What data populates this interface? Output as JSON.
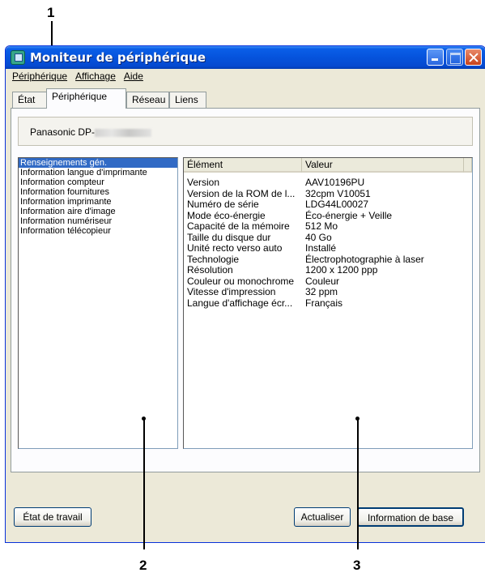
{
  "callouts": [
    "1",
    "2",
    "3"
  ],
  "window": {
    "title": "Moniteur de périphérique"
  },
  "menu": [
    {
      "label": "Périphérique"
    },
    {
      "label": "Affichage"
    },
    {
      "label": "Aide"
    }
  ],
  "tabs": [
    "État",
    "Périphérique",
    "Réseau",
    "Liens"
  ],
  "active_tab": "Périphérique",
  "device": {
    "name_prefix": "Panasonic DP-"
  },
  "left_list": [
    "Renseignements gén.",
    "Information langue d'imprimante",
    "Information compteur",
    "Information fournitures",
    "Information imprimante",
    "Information aire d'image",
    "Information numériseur",
    "Information télécopieur"
  ],
  "table": {
    "headers": [
      "Élément",
      "Valeur"
    ],
    "rows": [
      {
        "k": "Version",
        "v": "AAV10196PU"
      },
      {
        "k": "Version de la ROM de l...",
        "v": "32cpm V10051"
      },
      {
        "k": "Numéro de série",
        "v": "LDG44L00027"
      },
      {
        "k": "Mode éco-énergie",
        "v": "Éco-énergie + Veille"
      },
      {
        "k": "Capacité de la mémoire",
        "v": "512 Mo"
      },
      {
        "k": "Taille du disque dur",
        "v": "40 Go"
      },
      {
        "k": "Unité recto verso auto",
        "v": "Installé"
      },
      {
        "k": "Technologie",
        "v": "Électrophotographie à laser"
      },
      {
        "k": "Résolution",
        "v": "1200 x 1200 ppp"
      },
      {
        "k": "Couleur ou monochrome",
        "v": "Couleur"
      },
      {
        "k": "Vitesse d'impression",
        "v": "32 ppm"
      },
      {
        "k": "Langue d'affichage écr...",
        "v": "Français"
      }
    ]
  },
  "buttons": {
    "etat_travail": "État de travail",
    "actualiser": "Actualiser",
    "info_base": "Information de base"
  }
}
